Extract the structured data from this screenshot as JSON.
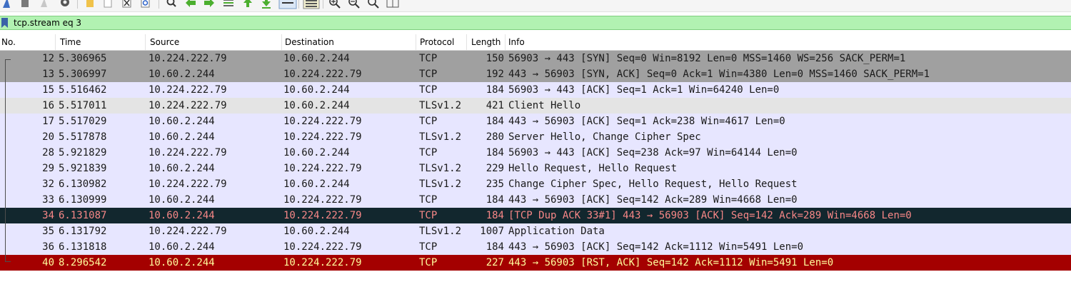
{
  "filter": {
    "value": "tcp.stream eq 3"
  },
  "columns": {
    "no": "No.",
    "time": "Time",
    "source": "Source",
    "destination": "Destination",
    "protocol": "Protocol",
    "length": "Length",
    "info": "Info"
  },
  "packets": [
    {
      "no": "12",
      "time": "5.306965",
      "source": "10.224.222.79",
      "destination": "10.60.2.244",
      "protocol": "TCP",
      "length": "150",
      "info": "56903 → 443 [SYN] Seq=0 Win=8192 Len=0 MSS=1460 WS=256 SACK_PERM=1"
    },
    {
      "no": "13",
      "time": "5.306997",
      "source": "10.60.2.244",
      "destination": "10.224.222.79",
      "protocol": "TCP",
      "length": "192",
      "info": "443 → 56903 [SYN, ACK] Seq=0 Ack=1 Win=4380 Len=0 MSS=1460 SACK_PERM=1"
    },
    {
      "no": "15",
      "time": "5.516462",
      "source": "10.224.222.79",
      "destination": "10.60.2.244",
      "protocol": "TCP",
      "length": "184",
      "info": "56903 → 443 [ACK] Seq=1 Ack=1 Win=64240 Len=0"
    },
    {
      "no": "16",
      "time": "5.517011",
      "source": "10.224.222.79",
      "destination": "10.60.2.244",
      "protocol": "TLSv1.2",
      "length": "421",
      "info": "Client Hello"
    },
    {
      "no": "17",
      "time": "5.517029",
      "source": "10.60.2.244",
      "destination": "10.224.222.79",
      "protocol": "TCP",
      "length": "184",
      "info": "443 → 56903 [ACK] Seq=1 Ack=238 Win=4617 Len=0"
    },
    {
      "no": "20",
      "time": "5.517878",
      "source": "10.60.2.244",
      "destination": "10.224.222.79",
      "protocol": "TLSv1.2",
      "length": "280",
      "info": "Server Hello, Change Cipher Spec"
    },
    {
      "no": "28",
      "time": "5.921829",
      "source": "10.224.222.79",
      "destination": "10.60.2.244",
      "protocol": "TCP",
      "length": "184",
      "info": "56903 → 443 [ACK] Seq=238 Ack=97 Win=64144 Len=0"
    },
    {
      "no": "29",
      "time": "5.921839",
      "source": "10.60.2.244",
      "destination": "10.224.222.79",
      "protocol": "TLSv1.2",
      "length": "229",
      "info": "Hello Request, Hello Request"
    },
    {
      "no": "32",
      "time": "6.130982",
      "source": "10.224.222.79",
      "destination": "10.60.2.244",
      "protocol": "TLSv1.2",
      "length": "235",
      "info": "Change Cipher Spec, Hello Request, Hello Request"
    },
    {
      "no": "33",
      "time": "6.130999",
      "source": "10.60.2.244",
      "destination": "10.224.222.79",
      "protocol": "TCP",
      "length": "184",
      "info": "443 → 56903 [ACK] Seq=142 Ack=289 Win=4668 Len=0"
    },
    {
      "no": "34",
      "time": "6.131087",
      "source": "10.60.2.244",
      "destination": "10.224.222.79",
      "protocol": "TCP",
      "length": "184",
      "info": "[TCP Dup ACK 33#1] 443 → 56903 [ACK] Seq=142 Ack=289 Win=4668 Len=0"
    },
    {
      "no": "35",
      "time": "6.131792",
      "source": "10.224.222.79",
      "destination": "10.60.2.244",
      "protocol": "TLSv1.2",
      "length": "1007",
      "info": "Application Data"
    },
    {
      "no": "36",
      "time": "6.131818",
      "source": "10.60.2.244",
      "destination": "10.224.222.79",
      "protocol": "TCP",
      "length": "184",
      "info": "443 → 56903 [ACK] Seq=142 Ack=1112 Win=5491 Len=0"
    },
    {
      "no": "40",
      "time": "8.296542",
      "source": "10.60.2.244",
      "destination": "10.224.222.79",
      "protocol": "TCP",
      "length": "227",
      "info": "443 → 56903 [RST, ACK] Seq=142 Ack=1112 Win=5491 Len=0"
    }
  ],
  "colors": {
    "syn": "#a0a0a0",
    "normal": "#e7e6ff",
    "client_hello": "#e4e4e4",
    "bad_tcp_bg": "#12272e",
    "bad_tcp_fg": "#f78787",
    "rst_bg": "#a40000",
    "rst_fg": "#fffc9c",
    "filter_ok": "#b2f2b2"
  }
}
